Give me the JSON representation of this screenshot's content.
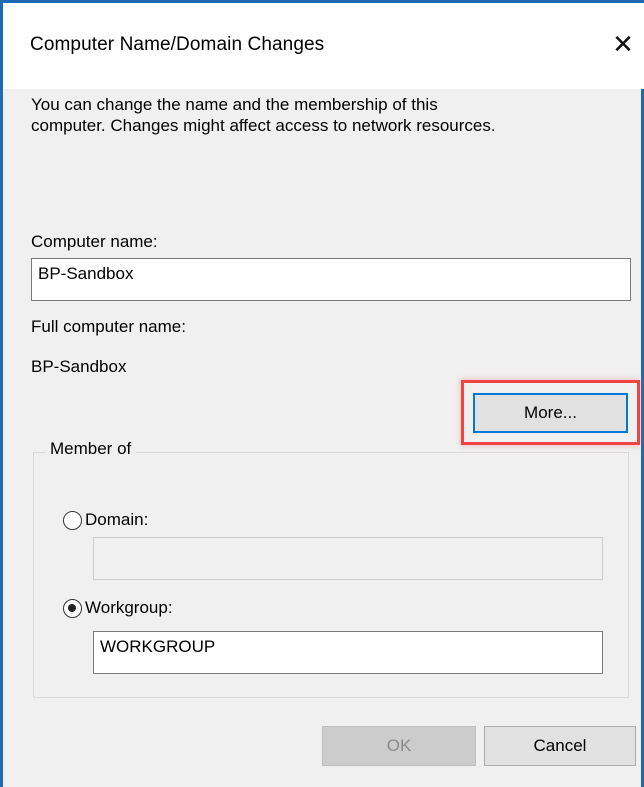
{
  "window": {
    "title": "Computer Name/Domain Changes",
    "close_glyph": "✕"
  },
  "description": {
    "line1": "You can change the name and the membership of this",
    "line2": "computer. Changes might affect access to network resources."
  },
  "computer_name": {
    "label": "Computer name:",
    "value": "BP-Sandbox"
  },
  "full_computer_name": {
    "label": "Full computer name:",
    "value": "BP-Sandbox"
  },
  "buttons": {
    "more": "More...",
    "ok": "OK",
    "cancel": "Cancel"
  },
  "member_of": {
    "legend": "Member of",
    "domain_label": "Domain:",
    "domain_value": "",
    "domain_selected": false,
    "workgroup_label": "Workgroup:",
    "workgroup_value": "WORKGROUP",
    "workgroup_selected": true
  },
  "colors": {
    "accent": "#0078d7",
    "highlight": "#ee4444",
    "window_border": "#1e6ab5"
  }
}
